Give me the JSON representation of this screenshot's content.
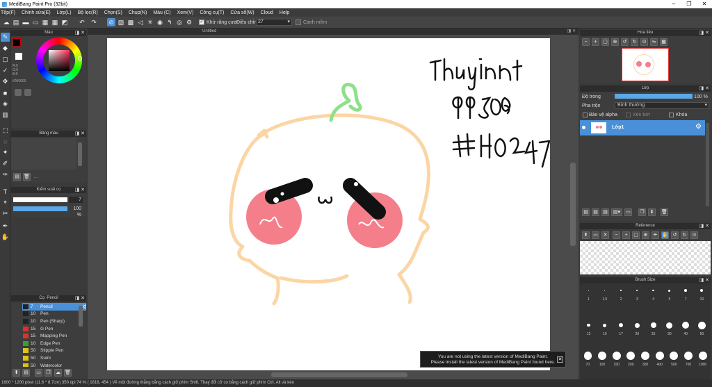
{
  "window": {
    "title": "MediBang Paint Pro (32bit)",
    "minimize": "–",
    "restore": "❐",
    "close": "✕"
  },
  "menu": [
    "Tệp(F)",
    "Chỉnh sửa(E)",
    "Lớp(L)",
    "Bộ lọc(R)",
    "Chọn(S)",
    "Chụp(N)",
    "Màu (C)",
    "Xem(V)",
    "Công cụ(T)",
    "Cửa sổ(W)",
    "Cloud",
    "Help"
  ],
  "toolbar": {
    "antialias_label": "Khử răng cưa",
    "adjust_label": "Điều chỉnh",
    "adjust_value": "27",
    "edge_label": "Cạnh mềm"
  },
  "document": {
    "tab_title": "Untitled"
  },
  "color_panel": {
    "title": "Màu",
    "r": "R:0",
    "g": "G:0",
    "b": "B:0",
    "hex": "#000000"
  },
  "palette_panel": {
    "title": "Bảng màu",
    "more": "…"
  },
  "brush_control": {
    "title": "Kiểm soát cọ",
    "size": "7",
    "opacity": "100 %"
  },
  "brush_panel": {
    "title": "Cọ: Pencil",
    "items": [
      {
        "size": "7",
        "name": "Pencil",
        "color": "#222222"
      },
      {
        "size": "10",
        "name": "Pen",
        "color": "#222222"
      },
      {
        "size": "10",
        "name": "Pen (Sharp)",
        "color": "#222222"
      },
      {
        "size": "15",
        "name": "G Pen",
        "color": "#d9342b"
      },
      {
        "size": "15",
        "name": "Mapping Pen",
        "color": "#d9342b"
      },
      {
        "size": "10",
        "name": "Edge Pen",
        "color": "#2fa52f"
      },
      {
        "size": "50",
        "name": "Stipple Pen",
        "color": "#e0c21a"
      },
      {
        "size": "50",
        "name": "Sumi",
        "color": "#e0c21a"
      },
      {
        "size": "50",
        "name": "Watercolor",
        "color": "#e0c21a"
      }
    ]
  },
  "navigator": {
    "title": "Hoa tiêu"
  },
  "layer_panel": {
    "title": "Lớp",
    "opacity_label": "Độ trong",
    "opacity_value": "100 %",
    "opacity_fraction": 1.0,
    "blend_label": "Pha trộn",
    "blend_value": "Bình thường",
    "protect_alpha": "Bảo vệ alpha",
    "clipping": "Xén bớt",
    "lock": "Khóa",
    "layers": [
      {
        "name": "Lớp1"
      }
    ]
  },
  "reference_panel": {
    "title": "Reference"
  },
  "brush_size_panel": {
    "title": "Brush Size",
    "rows": [
      [
        "1",
        "1.5",
        "2",
        "3",
        "4",
        "5",
        "7",
        "10"
      ],
      [
        "12",
        "15",
        "17",
        "20",
        "25",
        "30",
        "40",
        "50"
      ],
      [
        "70",
        "100",
        "150",
        "200",
        "300",
        "400",
        "500",
        "700",
        "1000"
      ]
    ]
  },
  "notice": {
    "line1": "You are not using the latest version of MediBang Paint.",
    "line2": "Please install the latest version of MediBang Paint found here.",
    "close": "✕"
  },
  "status": {
    "text": "1600 * 1200 pixel   (11.6 * 8.7cm)   350 dpi   74 %   ( 1616, 454 )   Vẽ một đường thẳng bằng cách giữ phím Shift, Thay đổi cỡ cọ bằng cách giữ phím Ctrl, Alt và kéo"
  },
  "artwork": {
    "colors": {
      "outline": "#fcd5a5",
      "sprout": "#8fe08a",
      "cheek": "#f47f8b",
      "eye": "#111111"
    }
  }
}
